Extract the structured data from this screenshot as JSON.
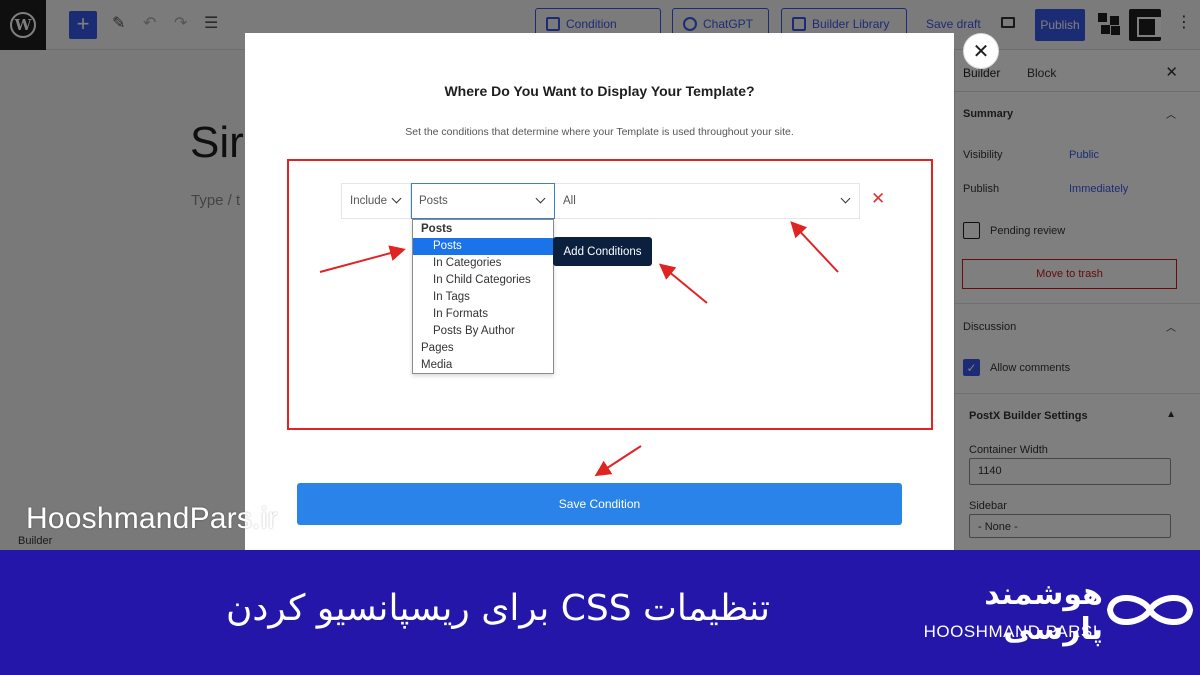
{
  "toolbar": {
    "condition_label": "Condition",
    "chatgpt_label": "ChatGPT",
    "builder_library_label": "Builder Library",
    "save_draft_label": "Save draft",
    "publish_label": "Publish"
  },
  "editor": {
    "title_fragment": "Sir",
    "body_hint": "Type / t",
    "footer_label": "Builder"
  },
  "sidebar": {
    "tab_builder": "Builder",
    "tab_block": "Block",
    "summary_label": "Summary",
    "visibility_label": "Visibility",
    "visibility_value": "Public",
    "publish_label": "Publish",
    "publish_value": "Immediately",
    "pending_review_label": "Pending review",
    "trash_label": "Move to trash",
    "discussion_label": "Discussion",
    "allow_comments_label": "Allow comments",
    "postx_label": "PostX Builder Settings",
    "container_width_label": "Container Width",
    "container_width_value": "1140",
    "sidebar_label": "Sidebar",
    "sidebar_value": "- None -"
  },
  "modal": {
    "title": "Where Do You Want to Display Your Template?",
    "description": "Set the conditions that determine where your Template is used throughout your site.",
    "include_value": "Include",
    "type_value": "Posts",
    "scope_value": "All",
    "dropdown": {
      "group": "Posts",
      "options": [
        "Posts",
        "In Categories",
        "In Child Categories",
        "In Tags",
        "In Formats",
        "Posts By Author"
      ],
      "selected_index": 0,
      "extra": [
        "Pages",
        "Media"
      ]
    },
    "add_conditions_label": "Add Conditions",
    "save_condition_label": "Save Condition"
  },
  "watermark": "HooshmandPars.ir",
  "banner": {
    "title": "تنظیمات CSS برای ریسپانسیو کردن",
    "brand_fa": "هوشمند پارسی",
    "brand_en": "HOOSHMAND PARSI"
  },
  "colors": {
    "accent": "#3858e9",
    "annotation_red": "#e02424",
    "banner_bg": "#2416a8",
    "save_button": "#2a83e8",
    "add_conditions_bg": "#0b1f3f"
  }
}
